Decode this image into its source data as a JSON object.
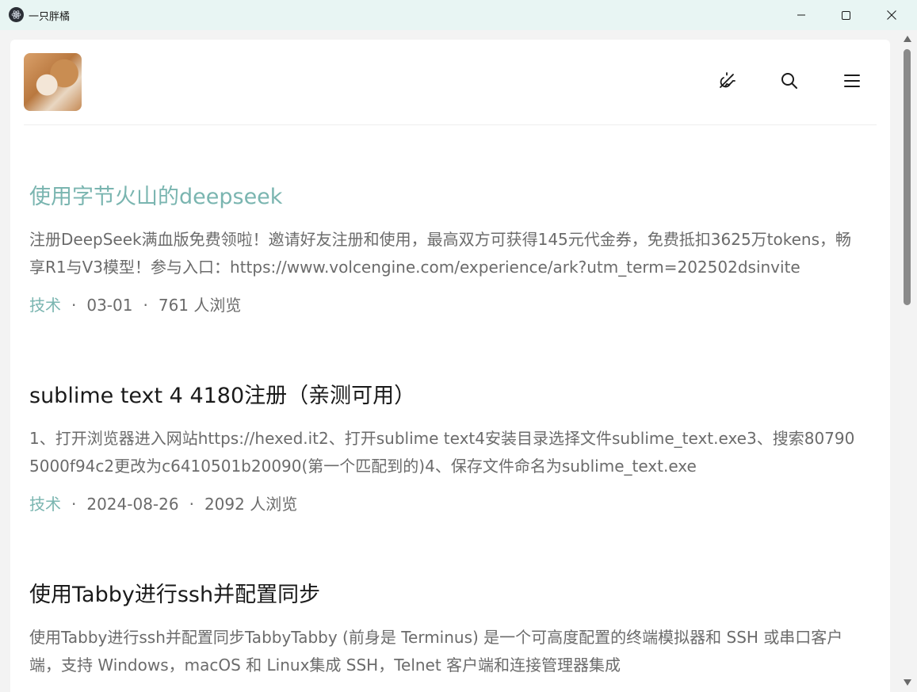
{
  "window": {
    "title": "一只胖橘",
    "icon": "electron-atom-icon"
  },
  "header": {
    "avatar": "cat-avatar",
    "icons": [
      "theme-toggle-icon",
      "search-icon",
      "menu-icon"
    ]
  },
  "posts": [
    {
      "title": "使用字节火山的deepseek",
      "excerpt": "注册DeepSeek满血版免费领啦！邀请好友注册和使用，最高双方可获得145元代金券，免费抵扣3625万tokens，畅享R1与V3模型！参与入口：https://www.volcengine.com/experience/ark?utm_term=202502dsinvite",
      "category": "技术",
      "date": "03-01",
      "views": "761 人浏览",
      "active": true
    },
    {
      "title": "sublime text 4 4180注册（亲测可用）",
      "excerpt": "1、打开浏览器进入网站https://hexed.it2、打开sublime text4安装目录选择文件sublime_text.exe3、搜索807905000f94c2更改为c6410501b20090(第一个匹配到的)4、保存文件命名为sublime_text.exe",
      "category": "技术",
      "date": "2024-08-26",
      "views": "2092 人浏览",
      "active": false
    },
    {
      "title": "使用Tabby进行ssh并配置同步",
      "excerpt": "使用Tabby进行ssh并配置同步TabbyTabby (前身是 Terminus) 是一个可高度配置的终端模拟器和 SSH 或串口客户端，支持 Windows，macOS 和 Linux集成 SSH，Telnet 客户端和连接管理器集成",
      "category": "",
      "date": "",
      "views": "",
      "active": false
    }
  ],
  "meta_separator": "·",
  "colors": {
    "accent": "#7ab5b0",
    "titlebar": "#e8f5f3",
    "text": "#1a1a1a",
    "muted": "#6b6b6b"
  }
}
